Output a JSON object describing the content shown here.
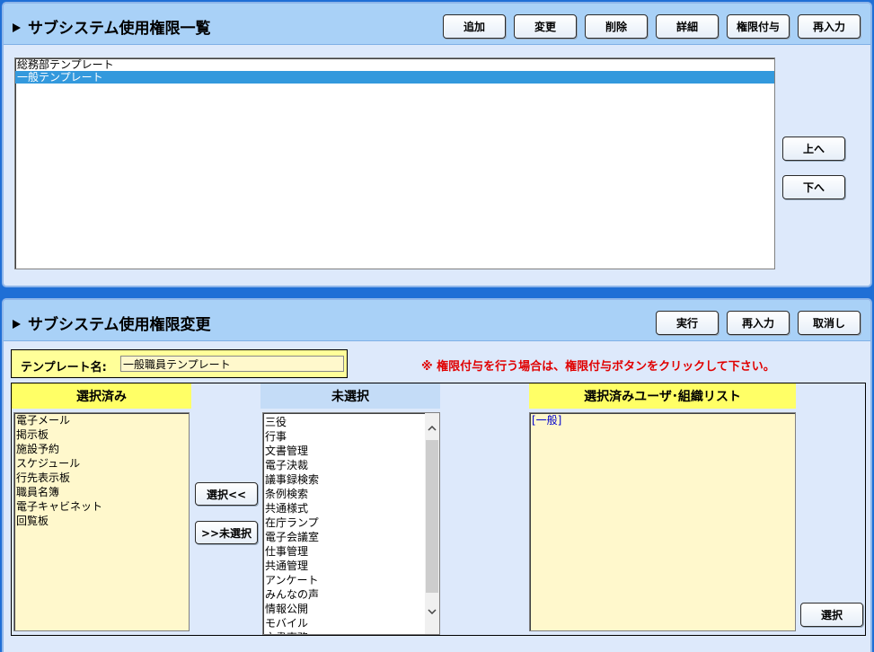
{
  "panel1": {
    "title": "サブシステム使用権限一覧",
    "buttons": {
      "add": "追加",
      "change": "変更",
      "delete": "削除",
      "detail": "詳細",
      "grant": "権限付与",
      "reenter": "再入力"
    },
    "templates": [
      {
        "label": "総務部テンプレート",
        "selected": false
      },
      {
        "label": "一般テンプレート",
        "selected": true
      }
    ],
    "up_label": "上へ",
    "down_label": "下へ"
  },
  "panel2": {
    "title": "サブシステム使用権限変更",
    "buttons": {
      "execute": "実行",
      "reenter": "再入力",
      "cancel": "取消し"
    },
    "template_name_label": "テンプレート名:",
    "template_name_value": "一般職員テンプレート",
    "notice": "※ 権限付与を行う場合は、権限付与ボタンをクリックして下さい。",
    "selected_header": "選択済み",
    "unselected_header": "未選択",
    "userlist_header": "選択済みユーザ･組織リスト",
    "selected_items": [
      "電子メール",
      "掲示板",
      "施設予約",
      "スケジュール",
      "行先表示板",
      "職員名簿",
      "電子キャビネット",
      "回覧板"
    ],
    "unselected_items": [
      "三役",
      "行事",
      "文書管理",
      "電子決裁",
      "議事録検索",
      "条例検索",
      "共通様式",
      "在庁ランプ",
      "電子会議室",
      "仕事管理",
      "共通管理",
      "アンケート",
      "みんなの声",
      "情報公開",
      "モバイル",
      "文書事務"
    ],
    "user_list_items": [
      "[一般]"
    ],
    "select_left_label": "選択<<",
    "unselect_label": ">>未選択",
    "select_button_label": "選択"
  },
  "colors": {
    "background": "#1f6fd6",
    "panel": "#dde9fb",
    "header": "#a9d1f7",
    "selection": "#3399dd",
    "notice": "#e00000",
    "column_yellow": "#ffff66",
    "list_pale": "#fff8cc",
    "link_blue": "#0000cc"
  },
  "icons": {
    "title_marker": "triangle-right-icon",
    "scroll_up": "chevron-up-icon",
    "scroll_down": "chevron-down-icon"
  }
}
